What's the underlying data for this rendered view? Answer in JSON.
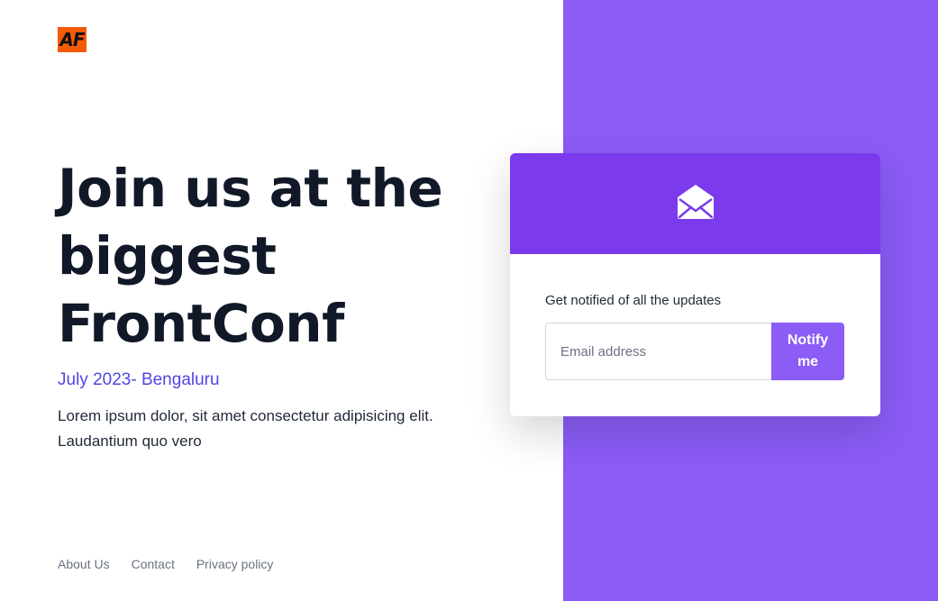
{
  "logo": {
    "text": "AF",
    "color": "#f25c05"
  },
  "hero": {
    "title": "Join us at the biggest FrontConf",
    "date": "July 2023- Bengaluru",
    "description": "Lorem ipsum dolor, sit amet consectetur adipisicing elit. Laudantium quo vero"
  },
  "footer": {
    "links": [
      {
        "label": "About Us"
      },
      {
        "label": "Contact"
      },
      {
        "label": "Privacy policy"
      }
    ]
  },
  "signup": {
    "icon": "envelope-open-icon",
    "label": "Get notified of all the updates",
    "email_placeholder": "Email address",
    "email_value": "",
    "button_label": "Notify me"
  },
  "colors": {
    "panel": "#8b5cf6",
    "card_header": "#7c3aed",
    "button": "#8b5cf6",
    "date_text": "#4f46e5",
    "title_text": "#111827"
  }
}
